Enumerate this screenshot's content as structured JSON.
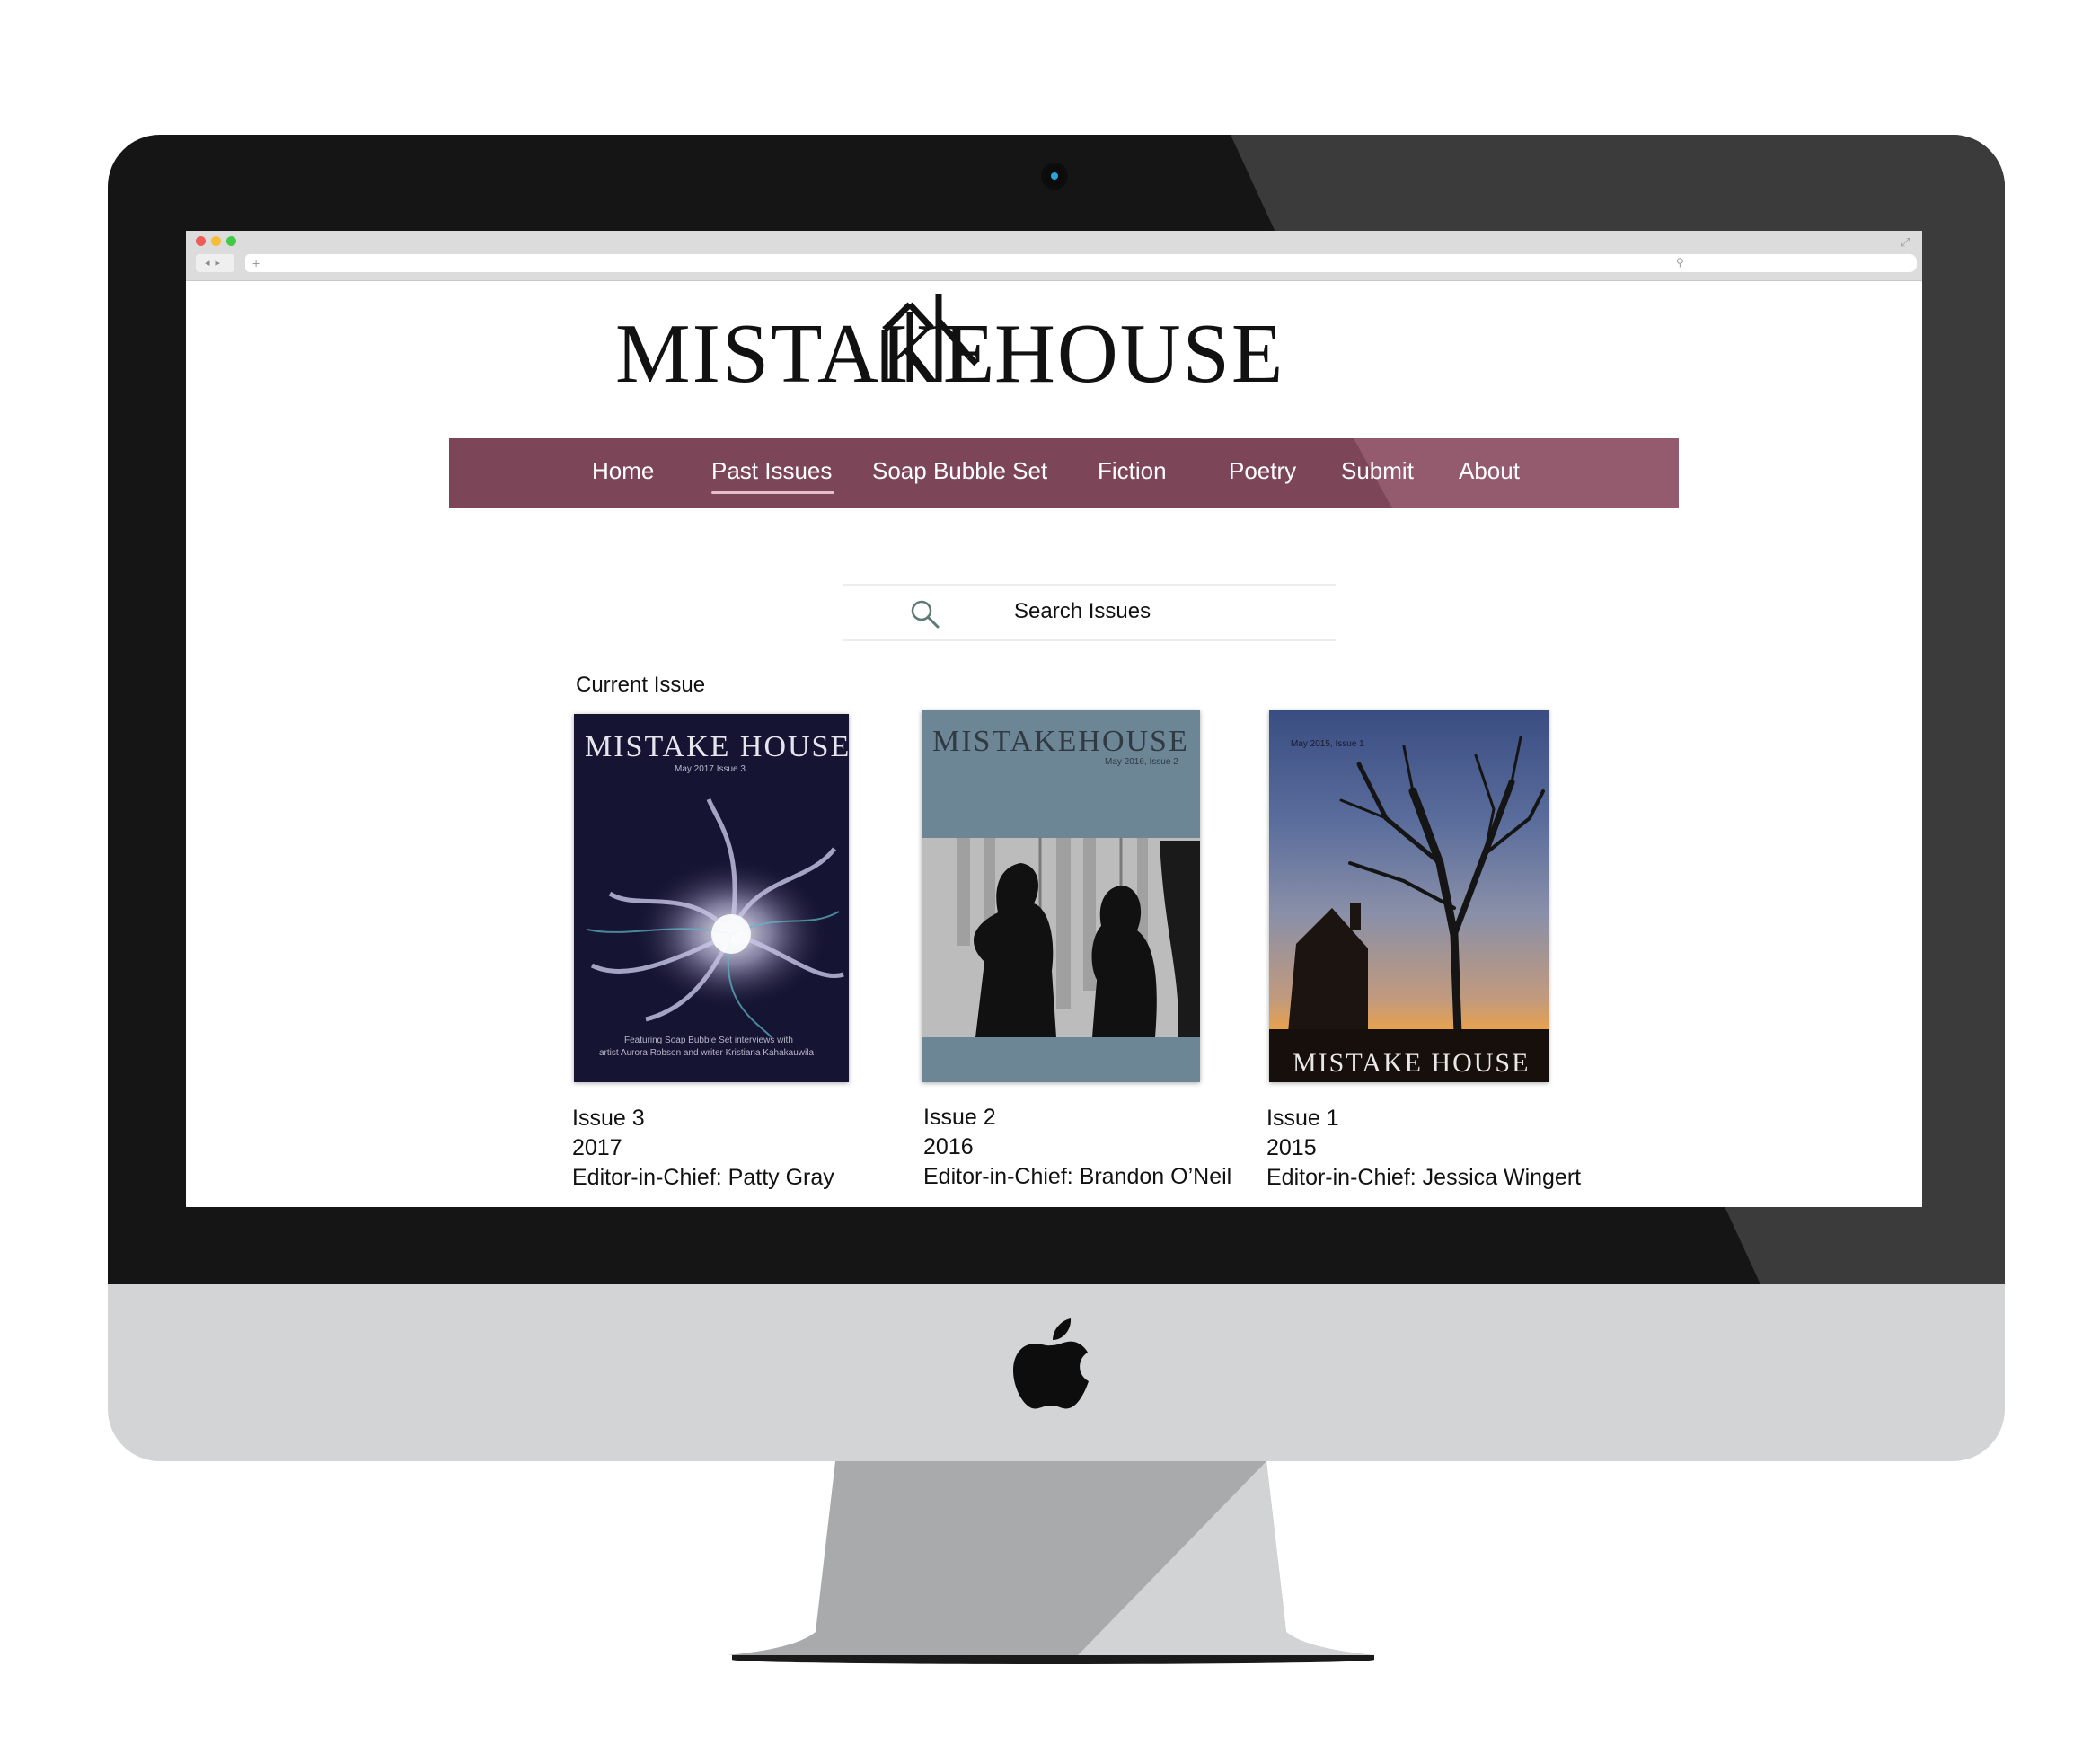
{
  "site": {
    "logo_left": "MISTAKE",
    "logo_right": "HOUSE"
  },
  "nav": {
    "items": [
      {
        "label": "Home"
      },
      {
        "label": "Past Issues",
        "active": true
      },
      {
        "label": "Soap Bubble Set"
      },
      {
        "label": "Fiction"
      },
      {
        "label": "Poetry"
      },
      {
        "label": "Submit"
      },
      {
        "label": "About"
      }
    ],
    "color": "#7c4558"
  },
  "search": {
    "label": "Search Issues"
  },
  "current_issue_label": "Current Issue",
  "issues": [
    {
      "issue": "Issue 3",
      "year": "2017",
      "editor": "Editor-in-Chief: Patty Gray",
      "cover_title": "MISTAKE HOUSE",
      "cover_subtitle": "May 2017 Issue 3",
      "cover_caption_1": "Featuring Soap Bubble Set interviews with",
      "cover_caption_2": "artist Aurora Robson and writer Kristiana Kahakauwila"
    },
    {
      "issue": "Issue 2",
      "year": "2016",
      "editor": "Editor-in-Chief: Brandon O’Neil",
      "cover_title": "MISTAKEHOUSE",
      "cover_subtitle": "May 2016, Issue 2"
    },
    {
      "issue": "Issue 1",
      "year": "2015",
      "editor": "Editor-in-Chief: Jessica Wingert",
      "cover_title": "MISTAKE HOUSE",
      "cover_subtitle": "May 2015, Issue 1"
    }
  ],
  "colors": {
    "accent": "#7c4558",
    "bezel": "#151515",
    "chin": "#d3d4d6"
  }
}
